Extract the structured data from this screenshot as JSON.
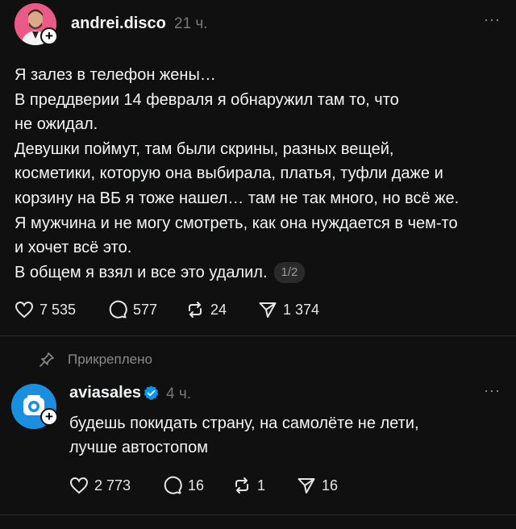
{
  "post": {
    "username": "andrei.disco",
    "time": "21 ч.",
    "more": "···",
    "lines": [
      "Я залез в телефон жены…",
      "В преддверии 14 февраля я обнаружил там то, что",
      "не ожидал.",
      "Девушки поймут, там были скрины, разных вещей,",
      "косметики, которую она выбирала, платья, туфли даже и",
      "корзину на ВБ я тоже нашел… там не так много, но всё же.",
      "Я мужчина и не могу смотреть, как она нуждается в чем-то",
      "и хочет всё это.",
      "В общем я взял и все это удалил."
    ],
    "page_badge": "1/2",
    "likes": "7 535",
    "comments": "577",
    "reposts": "24",
    "shares": "1 374"
  },
  "pinned": {
    "label": "Прикреплено"
  },
  "reply": {
    "username": "aviasales",
    "time": "4 ч.",
    "more": "···",
    "lines": [
      "будешь покидать страну, на самолёте не лети,",
      "лучше автостопом"
    ],
    "likes": "2 773",
    "comments": "16",
    "reposts": "1",
    "shares": "16"
  },
  "colors": {
    "background": "#101010",
    "verified": "#0095f6",
    "aviasales_brand": "#1a8fe0"
  }
}
